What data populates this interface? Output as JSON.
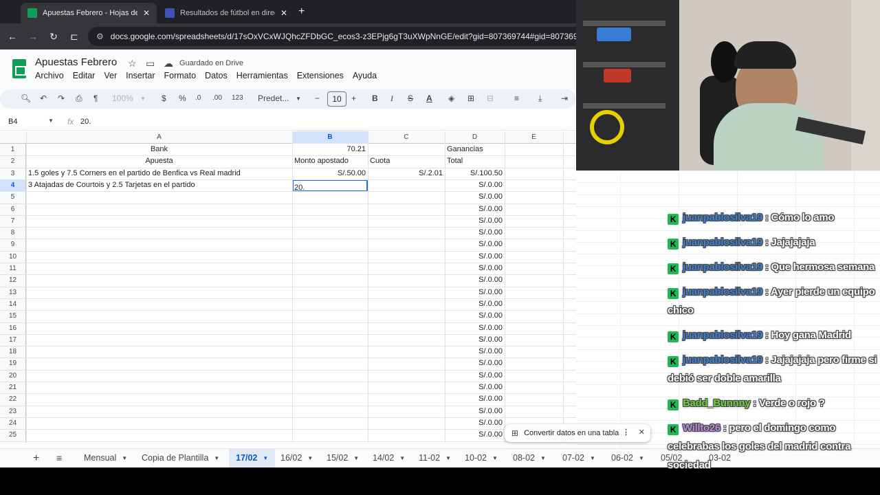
{
  "browser": {
    "tabs": [
      {
        "title": "Apuestas Febrero - Hojas de cálculo",
        "active": true,
        "favicon_color": "#0f9d58"
      },
      {
        "title": "Resultados de fútbol en directo",
        "active": false,
        "favicon_color": "#3f51b5"
      }
    ],
    "url": "docs.google.com/spreadsheets/d/17sOxVCxWJQhcZFDbGC_ecos3-z3EPjg6gT3uXWpNnGE/edit?gid=807369744#gid=807369744"
  },
  "sheets": {
    "doc_title": "Apuestas Febrero",
    "saved_status": "Guardado en Drive",
    "menu": [
      "Archivo",
      "Editar",
      "Ver",
      "Insertar",
      "Formato",
      "Datos",
      "Herramientas",
      "Extensiones",
      "Ayuda"
    ],
    "toolbar": {
      "zoom": "100%",
      "currency": "$",
      "percent": "%",
      "dec_decrease": ".0",
      "dec_increase": ".00",
      "number_format": "123",
      "font": "Predet...",
      "font_size": "10"
    },
    "name_box": "B4",
    "formula_value": "20.",
    "columns": [
      "A",
      "B",
      "C",
      "D",
      "E"
    ],
    "selected_column": "B",
    "selected_row": "4",
    "rows": [
      {
        "n": "1",
        "a": "Bank",
        "b": "70.21",
        "c": "",
        "d": "Ganancias"
      },
      {
        "n": "2",
        "a": "Apuesta",
        "b": "Monto apostado",
        "c": "Cuota",
        "d": "Total"
      },
      {
        "n": "3",
        "a": "1.5 goles y 7.5 Corners en el partido de Benfica vs Real madrid",
        "b": "S/.50.00",
        "c": "S/.2.01",
        "d": "S/.100.50"
      },
      {
        "n": "4",
        "a": "3 Atajadas de Courtois y 2.5 Tarjetas en el partido",
        "b": "",
        "c": "",
        "d": "S/.0.00"
      },
      {
        "n": "5",
        "a": "",
        "b": "",
        "c": "",
        "d": "S/.0.00"
      },
      {
        "n": "6",
        "a": "",
        "b": "",
        "c": "",
        "d": "S/.0.00"
      },
      {
        "n": "7",
        "a": "",
        "b": "",
        "c": "",
        "d": "S/.0.00"
      },
      {
        "n": "8",
        "a": "",
        "b": "",
        "c": "",
        "d": "S/.0.00"
      },
      {
        "n": "9",
        "a": "",
        "b": "",
        "c": "",
        "d": "S/.0.00"
      },
      {
        "n": "10",
        "a": "",
        "b": "",
        "c": "",
        "d": "S/.0.00"
      },
      {
        "n": "11",
        "a": "",
        "b": "",
        "c": "",
        "d": "S/.0.00"
      },
      {
        "n": "12",
        "a": "",
        "b": "",
        "c": "",
        "d": "S/.0.00"
      },
      {
        "n": "13",
        "a": "",
        "b": "",
        "c": "",
        "d": "S/.0.00"
      },
      {
        "n": "14",
        "a": "",
        "b": "",
        "c": "",
        "d": "S/.0.00"
      },
      {
        "n": "15",
        "a": "",
        "b": "",
        "c": "",
        "d": "S/.0.00"
      },
      {
        "n": "16",
        "a": "",
        "b": "",
        "c": "",
        "d": "S/.0.00"
      },
      {
        "n": "17",
        "a": "",
        "b": "",
        "c": "",
        "d": "S/.0.00"
      },
      {
        "n": "18",
        "a": "",
        "b": "",
        "c": "",
        "d": "S/.0.00"
      },
      {
        "n": "19",
        "a": "",
        "b": "",
        "c": "",
        "d": "S/.0.00"
      },
      {
        "n": "20",
        "a": "",
        "b": "",
        "c": "",
        "d": "S/.0.00"
      },
      {
        "n": "21",
        "a": "",
        "b": "",
        "c": "",
        "d": "S/.0.00"
      },
      {
        "n": "22",
        "a": "",
        "b": "",
        "c": "",
        "d": "S/.0.00"
      },
      {
        "n": "23",
        "a": "",
        "b": "",
        "c": "",
        "d": "S/.0.00"
      },
      {
        "n": "24",
        "a": "",
        "b": "",
        "c": "",
        "d": "S/.0.00"
      },
      {
        "n": "25",
        "a": "",
        "b": "",
        "c": "",
        "d": "S/.0.00"
      }
    ],
    "active_cell_value": "20.",
    "toast": {
      "label": "Convertir datos en una tabla"
    },
    "sheet_tabs": [
      "Mensual",
      "Copia de Plantilla",
      "17/02",
      "16/02",
      "15/02",
      "14/02",
      "11-02",
      "10-02",
      "08-02",
      "07-02",
      "06-02",
      "05/02",
      "03-02"
    ],
    "active_sheet": "17/02"
  },
  "chat": [
    {
      "user": "juanpablosilva19",
      "text": "Cómo lo amo",
      "color": "#3e7fd0"
    },
    {
      "user": "juanpablosilva19",
      "text": "Jajajajaja",
      "color": "#3e7fd0"
    },
    {
      "user": "juanpablosilva19",
      "text": "Que hermosa semana",
      "color": "#3e7fd0"
    },
    {
      "user": "juanpablosilva19",
      "text": "Ayer pierde un equipo chico",
      "color": "#3e7fd0"
    },
    {
      "user": "juanpablosilva19",
      "text": "Hoy gana Madrid",
      "color": "#3e7fd0"
    },
    {
      "user": "juanpablosilva19",
      "text": "Jajajajaja pero firme si debió ser doble amarilla",
      "color": "#3e7fd0"
    },
    {
      "user": "Badd_Bunnny",
      "text": "Verde o rojo ?",
      "color": "#6fcf3c"
    },
    {
      "user": "Willto26",
      "text": "pero el domingo como celebrabas los goles del madrid contra sociedad",
      "color": "#b98ae0"
    }
  ],
  "chat_badge": "K"
}
